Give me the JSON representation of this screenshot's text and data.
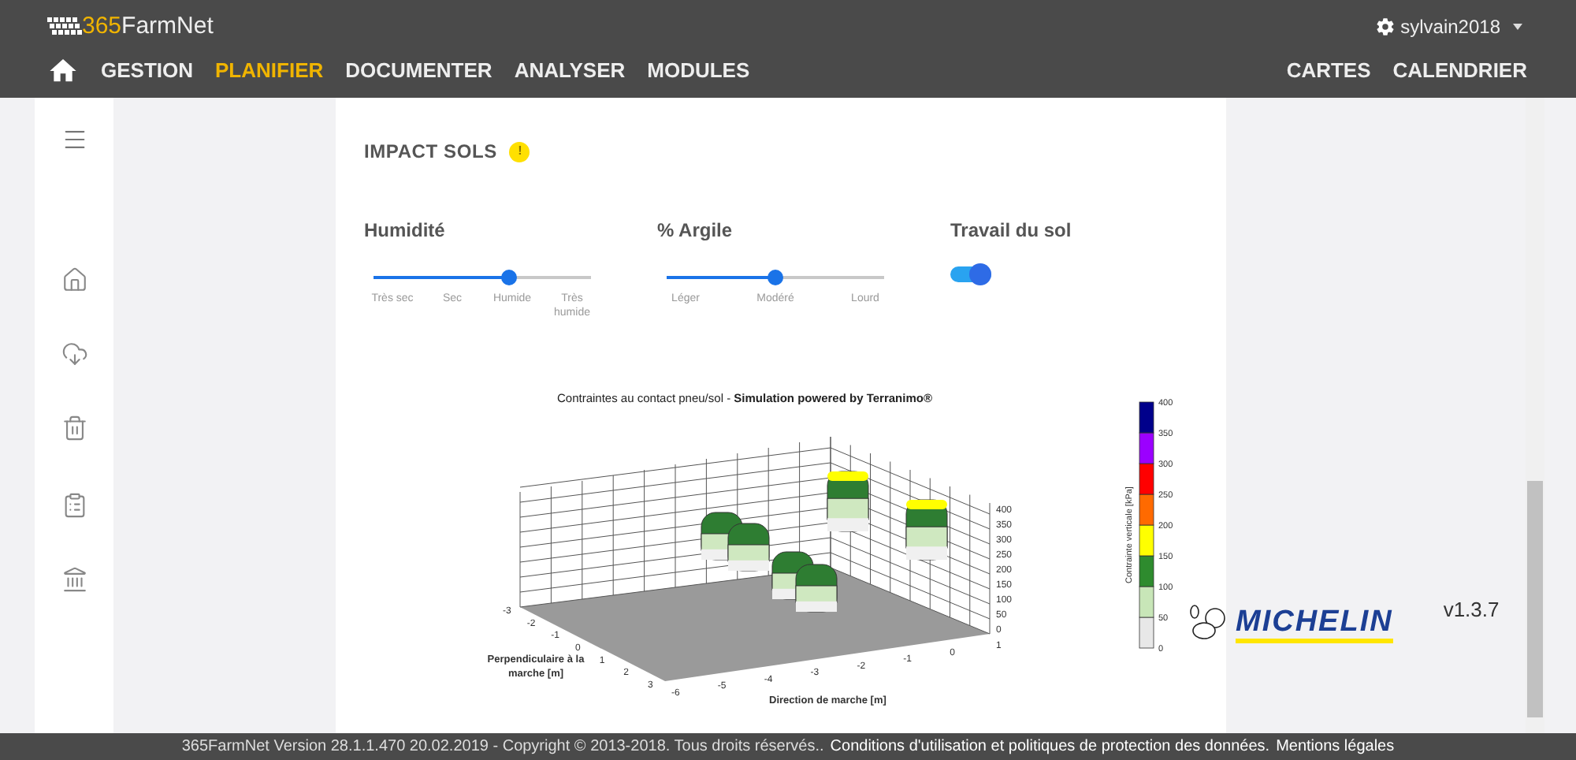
{
  "header": {
    "logo": {
      "number": "365",
      "name": "FarmNet"
    },
    "user": "sylvain2018",
    "nav": [
      {
        "label": "GESTION",
        "selected": false
      },
      {
        "label": "PLANIFIER",
        "selected": true
      },
      {
        "label": "DOCUMENTER",
        "selected": false
      },
      {
        "label": "ANALYSER",
        "selected": false
      },
      {
        "label": "MODULES",
        "selected": false
      }
    ],
    "nav_right": [
      "CARTES",
      "CALENDRIER"
    ]
  },
  "section": {
    "title": "IMPACT SOLS",
    "badge": "!"
  },
  "sliders": [
    {
      "label": "Humidité",
      "level": 0.62,
      "ticks": [
        "Très sec",
        "Sec",
        "Humide",
        "Très humide"
      ]
    },
    {
      "label": "% Argile",
      "level": 0.5,
      "ticks": [
        "Léger",
        "Modéré",
        "Lourd"
      ]
    }
  ],
  "toggle": {
    "label": "Travail du sol",
    "on": true
  },
  "chart": {
    "title": "Contraintes au contact pneu/sol - **Simulation powered by Terranimo®**",
    "xlabel": "Direction de marche [m]",
    "ylabel": "Perpendiculaire à la marche [m]",
    "xticks": [
      "-6",
      "-5",
      "-4",
      "-3",
      "-2",
      "-1",
      "0",
      "1"
    ],
    "yticks": [
      "-3",
      "-2",
      "-1",
      "0",
      "1",
      "2",
      "3"
    ],
    "zticks": [
      "400",
      "350",
      "300",
      "250",
      "200",
      "150",
      "100",
      "50",
      "0"
    ]
  },
  "legend": {
    "label": "Contrainte verticale [kPa]",
    "ticks": [
      "400",
      "350",
      "300",
      "250",
      "200",
      "150",
      "100",
      "50",
      "0"
    ],
    "bands": [
      {
        "color": "#e8e8e8"
      },
      {
        "color": "#c8e6b8"
      },
      {
        "color": "#2e8b2e"
      },
      {
        "color": "#ffff00"
      },
      {
        "color": "#ff6a00"
      },
      {
        "color": "#ff0000"
      },
      {
        "color": "#9b00ff"
      },
      {
        "color": "#00008b"
      }
    ]
  },
  "brand": "MICHELIN",
  "version": "v1.3.7",
  "footer": {
    "text": "365FarmNet Version 28.1.1.470 20.02.2019 - Copyright © 2013-2018. Tous droits réservés..",
    "links": [
      "Conditions d'utilisation et politiques de protection des données.",
      "Mentions légales"
    ]
  }
}
